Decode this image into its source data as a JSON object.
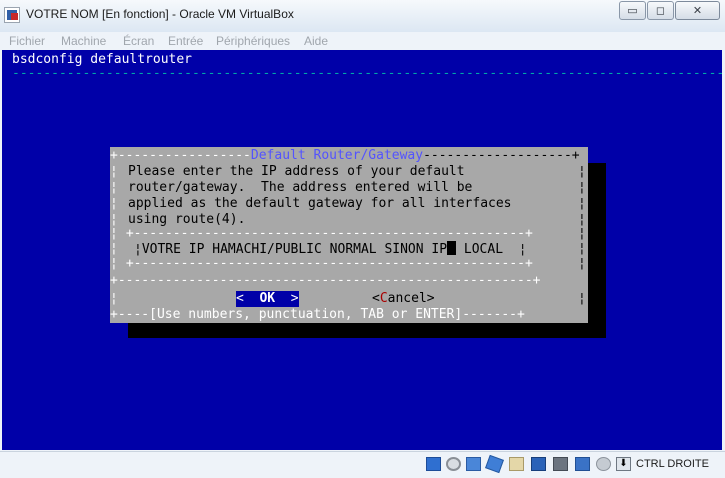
{
  "window": {
    "title": "VOTRE NOM [En fonction] - Oracle VM VirtualBox",
    "controls": {
      "minimize": "▭",
      "maximize": "◻",
      "close": "✕"
    }
  },
  "menu": {
    "items": [
      {
        "label": "Fichier"
      },
      {
        "label": "Machine"
      },
      {
        "label": "Écran"
      },
      {
        "label": "Entrée"
      },
      {
        "label": "Périphériques"
      },
      {
        "label": "Aide"
      }
    ]
  },
  "console": {
    "header_title": "bsdconfig defaultrouter",
    "header_rule": "-------------------------------------------------------------------------------------------------",
    "dialog": {
      "title": "Default Router/Gateway",
      "top_border_left": "+-----------------",
      "top_border_right": "-------------------+",
      "prompt_lines": [
        "Please enter the IP address of your default",
        "router/gateway.  The address entered will be",
        "applied as the default gateway for all interfaces",
        "using route(4)."
      ],
      "inner_top": " +--------------------------------------------------+",
      "input_before_cursor": "¦VOTRE IP HAMACHI/PUBLIC NORMAL SINON IP",
      "input_after_cursor": " LOCAL  ¦",
      "inner_bottom": " +--------------------------------------------------+",
      "separator": "+-----------------------------------------------------+",
      "ok_label": "OK",
      "cancel_label_before": "<",
      "cancel_hotkey": "C",
      "cancel_label_after": "ancel>",
      "footer": "+----[Use numbers, punctuation, TAB or ENTER]-------+"
    }
  },
  "statusbar": {
    "icons": [
      "hard-disk-icon",
      "optical-drive-icon",
      "usb-icon",
      "network-icon",
      "shared-folders-icon",
      "display-icon",
      "video-capture-icon",
      "guest-additions-icon",
      "mouse-integration-icon",
      "host-key-arrow-icon"
    ],
    "host_key": "CTRL DROITE"
  }
}
